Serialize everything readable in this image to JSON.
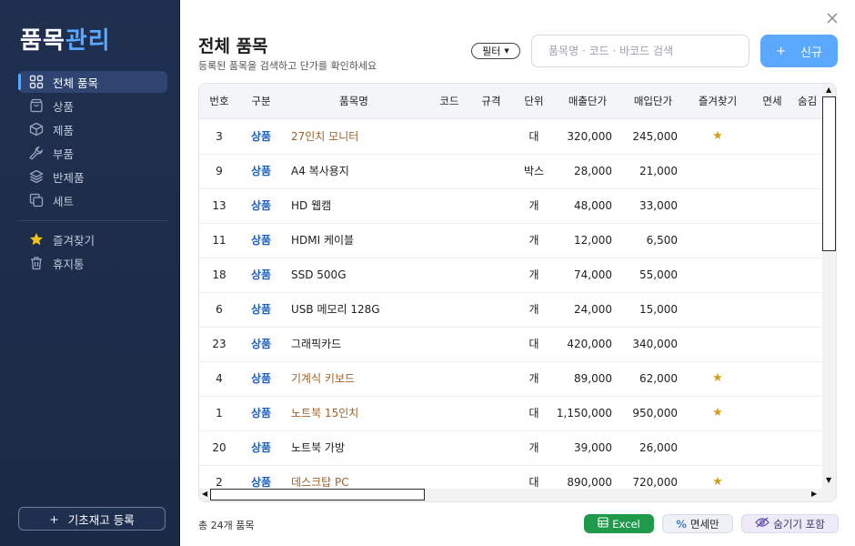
{
  "app": {
    "logo_part1": "품목",
    "logo_part2": "관리"
  },
  "sidebar": {
    "items": [
      {
        "label": "전체 품목",
        "icon": "grid-icon",
        "active": true
      },
      {
        "label": "상품",
        "icon": "bag-icon",
        "active": false
      },
      {
        "label": "제품",
        "icon": "box-icon",
        "active": false
      },
      {
        "label": "부품",
        "icon": "wrench-icon",
        "active": false
      },
      {
        "label": "반제품",
        "icon": "layers-icon",
        "active": false
      },
      {
        "label": "세트",
        "icon": "copy-icon",
        "active": false
      }
    ],
    "extra_items": [
      {
        "label": "즐겨찾기",
        "icon": "star-icon"
      },
      {
        "label": "휴지통",
        "icon": "trash-icon"
      }
    ],
    "stock_button": {
      "plus": "+",
      "label": "기초재고 등록"
    }
  },
  "header": {
    "title": "전체 품목",
    "subtitle": "등록된 품목을 검색하고 단가를 확인하세요",
    "filter_label": "필터",
    "search_placeholder": "품목명 · 코드 · 바코드 검색",
    "new_plus": "+",
    "new_label": "신규"
  },
  "table": {
    "columns": [
      "번호",
      "구분",
      "품목명",
      "코드",
      "규격",
      "단위",
      "매출단가",
      "매입단가",
      "즐겨찾기",
      "면세",
      "숨김"
    ],
    "rows": [
      {
        "no": "3",
        "cat": "상품",
        "name": "27인치 모니터",
        "unit": "대",
        "sale": "320,000",
        "buy": "245,000",
        "fav": true
      },
      {
        "no": "9",
        "cat": "상품",
        "name": "A4 복사용지",
        "unit": "박스",
        "sale": "28,000",
        "buy": "21,000",
        "fav": false
      },
      {
        "no": "13",
        "cat": "상품",
        "name": "HD 웹캠",
        "unit": "개",
        "sale": "48,000",
        "buy": "33,000",
        "fav": false
      },
      {
        "no": "11",
        "cat": "상품",
        "name": "HDMI 케이블",
        "unit": "개",
        "sale": "12,000",
        "buy": "6,500",
        "fav": false
      },
      {
        "no": "18",
        "cat": "상품",
        "name": "SSD 500G",
        "unit": "개",
        "sale": "74,000",
        "buy": "55,000",
        "fav": false
      },
      {
        "no": "6",
        "cat": "상품",
        "name": "USB 메모리 128G",
        "unit": "개",
        "sale": "24,000",
        "buy": "15,000",
        "fav": false
      },
      {
        "no": "23",
        "cat": "상품",
        "name": "그래픽카드",
        "unit": "대",
        "sale": "420,000",
        "buy": "340,000",
        "fav": false
      },
      {
        "no": "4",
        "cat": "상품",
        "name": "기계식 키보드",
        "unit": "개",
        "sale": "89,000",
        "buy": "62,000",
        "fav": true
      },
      {
        "no": "1",
        "cat": "상품",
        "name": "노트북 15인치",
        "unit": "대",
        "sale": "1,150,000",
        "buy": "950,000",
        "fav": true
      },
      {
        "no": "20",
        "cat": "상품",
        "name": "노트북 가방",
        "unit": "개",
        "sale": "39,000",
        "buy": "26,000",
        "fav": false
      },
      {
        "no": "2",
        "cat": "상품",
        "name": "데스크탑 PC",
        "unit": "대",
        "sale": "890,000",
        "buy": "720,000",
        "fav": true
      }
    ],
    "fav_symbol": "★"
  },
  "footer": {
    "total": "총 24개 품목",
    "excel_label": "Excel",
    "taxfree_label": "면세만",
    "hidden_label": "숨기기 포함"
  },
  "colors": {
    "accent": "#5aa8ff",
    "sidebar_bg": "#1f2f4f",
    "excel": "#1f9a4a",
    "favorite_name": "#a0622a"
  }
}
